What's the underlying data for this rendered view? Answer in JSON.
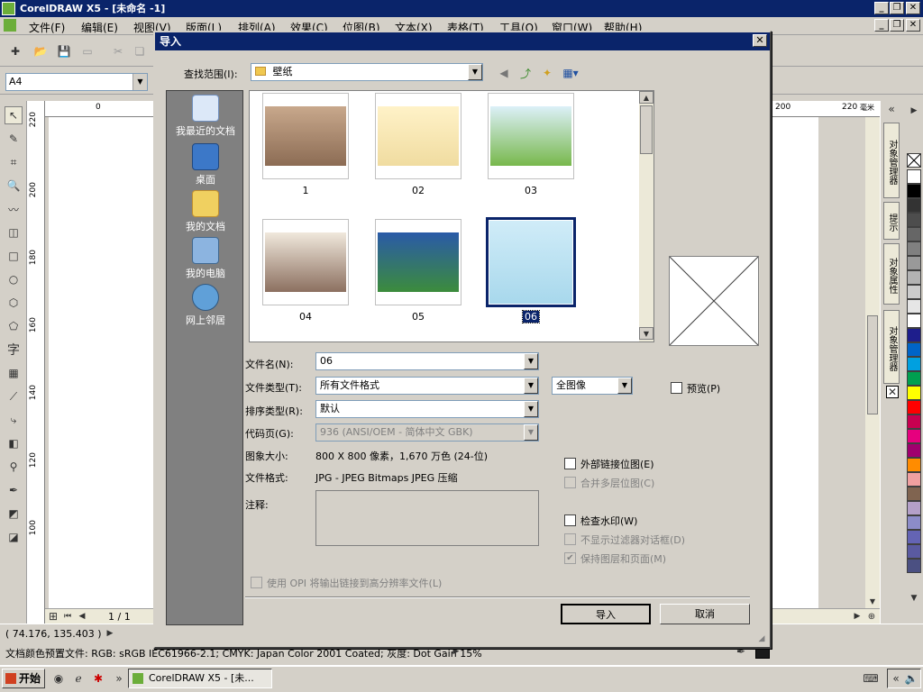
{
  "app": {
    "title": "CorelDRAW X5 - [未命名 -1]",
    "menu": [
      "文件(F)",
      "编辑(E)",
      "视图(V)",
      "版面(L)",
      "排列(A)",
      "效果(C)",
      "位图(B)",
      "文本(X)",
      "表格(T)",
      "工具(O)",
      "窗口(W)",
      "帮助(H)"
    ],
    "page_size": "A4",
    "ruler_h": [
      "0",
      "200",
      "220",
      "毫米"
    ],
    "ruler_v": [
      "220",
      "200",
      "180",
      "160",
      "140",
      "120",
      "100"
    ],
    "page_nav": "1 / 1",
    "docker_tabs": [
      "对象管理器",
      "提示",
      "对象属性",
      "对象管理器"
    ],
    "coords": "( 74.176, 135.403 )",
    "color_profile": "文档颜色预置文件: RGB: sRGB IEC61966-2.1; CMYK: Japan Color 2001 Coated; 灰度: Dot Gain 15%",
    "palette": [
      "#ffffff",
      "#000000",
      "#333333",
      "#4d4d4d",
      "#666666",
      "#808080",
      "#999999",
      "#b3b3b3",
      "#cccccc",
      "#e6e6e6",
      "#ffffff",
      "#1e1e8c",
      "#0064c8",
      "#00a0e0",
      "#00a050",
      "#ffff00",
      "#ff0000",
      "#c80050",
      "#e6007e",
      "#a0006e",
      "#ff8c00",
      "#f0a0a0",
      "#806450",
      "#b4a0c8",
      "#8c8cc8",
      "#6464b4",
      "#5a5aa0",
      "#4b5082"
    ]
  },
  "taskbar": {
    "start": "开始",
    "task": "CorelDRAW X5 - [未..."
  },
  "dialog": {
    "title": "导入",
    "look_in_label": "查找范围(I):",
    "look_in_value": "壁纸",
    "places": [
      "我最近的文档",
      "桌面",
      "我的文档",
      "我的电脑",
      "网上邻居"
    ],
    "thumbs": [
      {
        "caption": "1",
        "c1": "#c8a88c",
        "c2": "#8c6c54"
      },
      {
        "caption": "02",
        "c1": "#fff2c8",
        "c2": "#f0dca0"
      },
      {
        "caption": "03",
        "c1": "#dcf0f8",
        "c2": "#78b84c"
      },
      {
        "caption": "04",
        "c1": "#f0e8dc",
        "c2": "#8c7060"
      },
      {
        "caption": "05",
        "c1": "#2a5aa8",
        "c2": "#3c8c3c"
      },
      {
        "caption": "06",
        "c1": "#d0ecf8",
        "c2": "#a8d8ec"
      }
    ],
    "filename_label": "文件名(N):",
    "filename_value": "06",
    "filetype_label": "文件类型(T):",
    "filetype_value": "所有文件格式",
    "image_mode": "全图像",
    "preview_label": "预览(P)",
    "sort_label": "排序类型(R):",
    "sort_value": "默认",
    "codepage_label": "代码页(G):",
    "codepage_value": "936  (ANSI/OEM - 简体中文 GBK)",
    "size_label": "图象大小:",
    "size_value": "800 X 800 像素，1,670 万色 (24-位)",
    "format_label": "文件格式:",
    "format_value": "JPG - JPEG Bitmaps JPEG 压缩",
    "notes_label": "注释:",
    "opts": {
      "external_link": "外部链接位图(E)",
      "merge_layers": "合并多层位图(C)",
      "watermark": "检查水印(W)",
      "no_filter": "不显示过滤器对话框(D)",
      "keep_layers": "保持图层和页面(M)"
    },
    "opi_label": "使用 OPI 将输出链接到高分辨率文件(L)",
    "import_btn": "导入",
    "cancel_btn": "取消"
  }
}
